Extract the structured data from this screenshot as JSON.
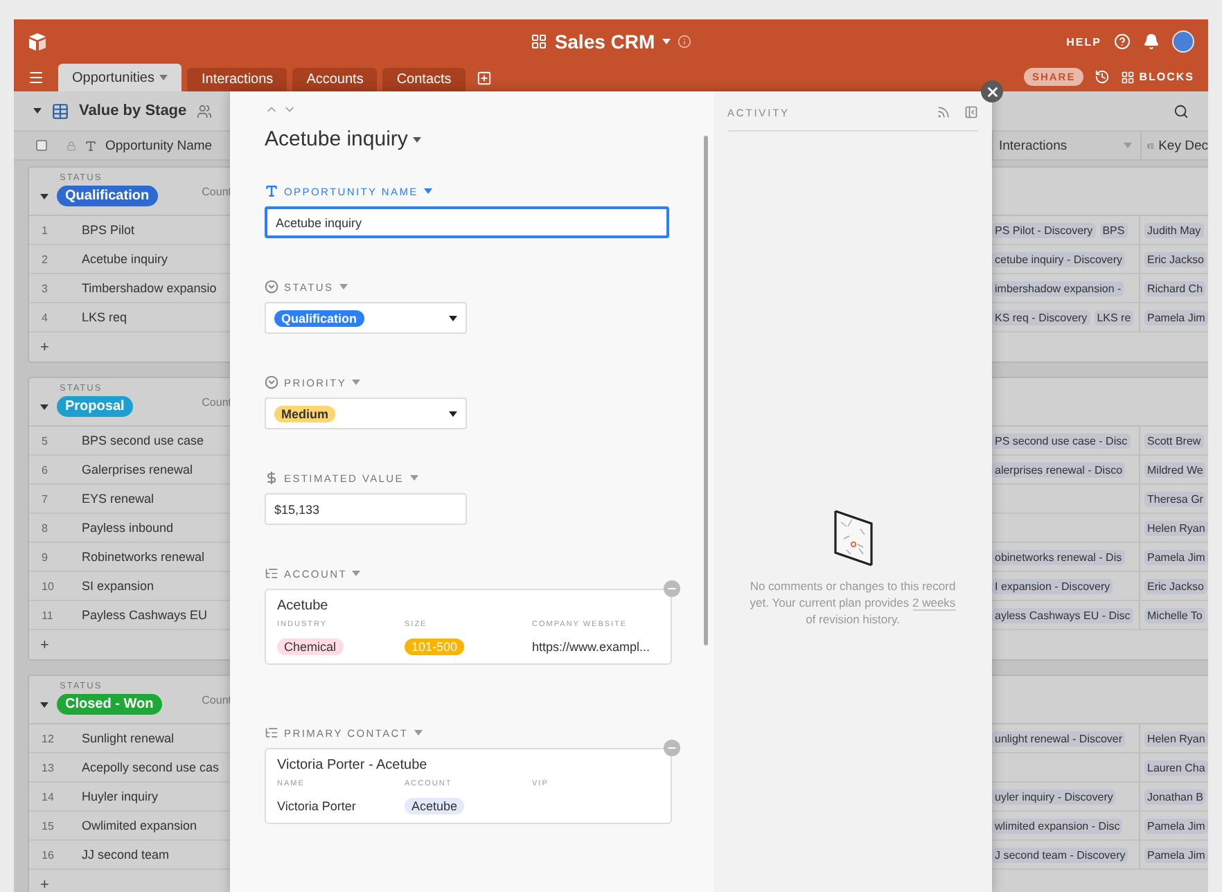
{
  "app": {
    "title": "Sales CRM",
    "help": "HELP",
    "share": "SHARE",
    "blocks": "BLOCKS"
  },
  "tabs": [
    {
      "label": "Opportunities",
      "selected": true
    },
    {
      "label": "Interactions",
      "selected": false
    },
    {
      "label": "Accounts",
      "selected": false
    },
    {
      "label": "Contacts",
      "selected": false
    }
  ],
  "view": {
    "name": "Value by Stage"
  },
  "columns": {
    "select_all": {
      "checked": false
    },
    "primary": "Opportunity Name",
    "column_2": "Interactions",
    "column_3": "Key Dec"
  },
  "groups": [
    {
      "field": "STATUS",
      "status": "Qualification",
      "color": "#2e6ad1",
      "count": "Count",
      "add": "+",
      "rows": [
        {
          "number": "1",
          "name": "BPS Pilot",
          "interactions": [
            "PS Pilot - Discovery",
            "BPS"
          ],
          "contact": "Judith May"
        },
        {
          "number": "2",
          "name": "Acetube inquiry",
          "interactions": [
            "cetube inquiry - Discovery"
          ],
          "contact": "Eric Jackso"
        },
        {
          "number": "3",
          "name": "Timbershadow expansio",
          "interactions": [
            "imbershadow expansion -"
          ],
          "contact": "Richard Ch"
        },
        {
          "number": "4",
          "name": "LKS req",
          "interactions": [
            "KS req - Discovery",
            "LKS re"
          ],
          "contact": "Pamela Jim"
        }
      ]
    },
    {
      "field": "STATUS",
      "status": "Proposal",
      "color": "#1f9fd0",
      "count": "Count",
      "add": "+",
      "rows": [
        {
          "number": "5",
          "name": "BPS second use case",
          "interactions": [
            "PS second use case - Disc"
          ],
          "contact": "Scott Brew"
        },
        {
          "number": "6",
          "name": "Galerprises renewal",
          "interactions": [
            "alerprises renewal - Disco"
          ],
          "contact": "Mildred We"
        },
        {
          "number": "7",
          "name": "EYS renewal",
          "contact": "Theresa Gr"
        },
        {
          "number": "8",
          "name": "Payless inbound",
          "contact": "Helen Ryan"
        },
        {
          "number": "9",
          "name": "Robinetworks renewal",
          "interactions": [
            "obinetworks renewal - Dis"
          ],
          "contact": "Pamela Jim"
        },
        {
          "number": "10",
          "name": "SI expansion",
          "interactions": [
            "I expansion - Discovery"
          ],
          "contact": "Eric Jackso"
        },
        {
          "number": "11",
          "name": "Payless Cashways EU",
          "interactions": [
            "ayless Cashways EU - Disc"
          ],
          "contact": "Michelle To"
        }
      ]
    },
    {
      "field": "STATUS",
      "status": "Closed - Won",
      "color": "#1fa837",
      "count": "Count",
      "add": "+",
      "rows": [
        {
          "number": "12",
          "name": "Sunlight renewal",
          "interactions": [
            "unlight renewal - Discover"
          ],
          "contact": "Helen Ryan"
        },
        {
          "number": "13",
          "name": "Acepolly second use cas",
          "contact": "Lauren Cha"
        },
        {
          "number": "14",
          "name": "Huyler inquiry",
          "interactions": [
            "uyler inquiry - Discovery"
          ],
          "contact": "Jonathan B"
        },
        {
          "number": "15",
          "name": "Owlimited expansion",
          "interactions": [
            "wlimited expansion - Disc"
          ],
          "contact": "Pamela Jim"
        },
        {
          "number": "16",
          "name": "JJ second team",
          "interactions": [
            "J second team - Discovery"
          ],
          "contact": "Pamela Jim"
        }
      ]
    }
  ],
  "record": {
    "title": "Acetube inquiry",
    "fields": [
      {
        "kind": "text",
        "label": "OPPORTUNITY NAME",
        "value": "Acetube inquiry",
        "focused": true
      },
      {
        "kind": "select",
        "label": "STATUS",
        "value": "Qualification",
        "color": "#2d7ff9"
      },
      {
        "kind": "select",
        "label": "PRIORITY",
        "value": "Medium",
        "color": "#ffd66e"
      },
      {
        "kind": "currency",
        "label": "ESTIMATED VALUE",
        "value": "$15,133",
        "focused": false
      },
      {
        "kind": "link",
        "label": "ACCOUNT",
        "card": {
          "title": "Acetube",
          "columns": [
            {
              "label": "INDUSTRY",
              "value": "Chemical",
              "color": "#ffdce5"
            },
            {
              "label": "SIZE",
              "value": "101-500",
              "color": "#fcb400"
            },
            {
              "label": "COMPANY WEBSITE",
              "value": "https://www.exampl..."
            }
          ]
        }
      },
      {
        "kind": "link",
        "label": "PRIMARY CONTACT",
        "card": {
          "title": "Victoria Porter - Acetube",
          "columns": [
            {
              "label": "NAME",
              "value": "Victoria Porter"
            },
            {
              "label": "ACCOUNT",
              "value": "Acetube",
              "color": "#e3e9f8"
            },
            {
              "label": "VIP"
            }
          ]
        }
      }
    ]
  },
  "activity": {
    "heading": "ACTIVITY",
    "message": "No comments or changes to this record yet. Your current plan provides",
    "link": "2 weeks",
    "message_end": "of revision history."
  }
}
